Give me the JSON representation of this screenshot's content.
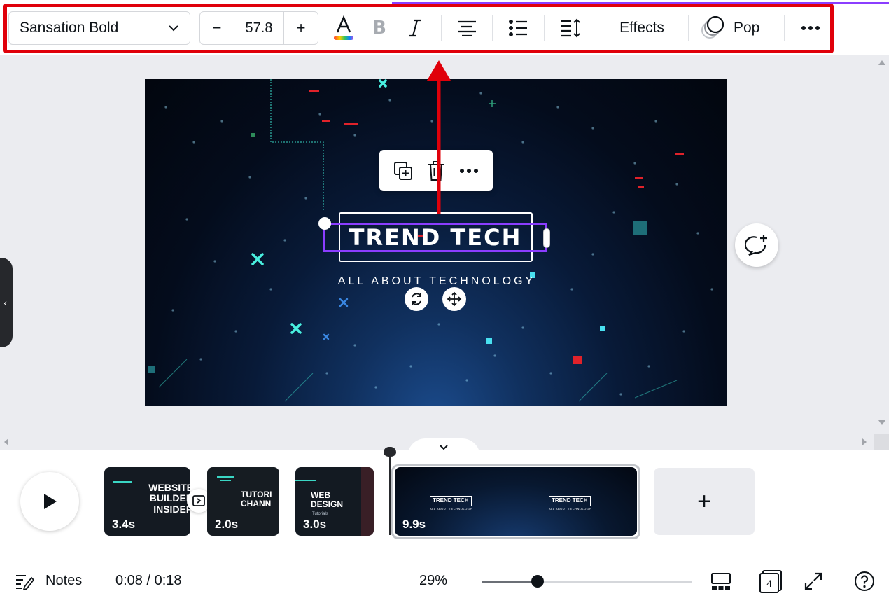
{
  "toolbar": {
    "font_name": "Sansation Bold",
    "font_size": "57.8",
    "decrease_label": "−",
    "increase_label": "+",
    "effects_label": "Effects",
    "animation_label": "Pop",
    "highlight_color": "#e0000a",
    "text_color_icon": "text-color-icon",
    "bold_icon": "bold-icon",
    "italic_icon": "italic-icon",
    "align_icon": "align-center-icon",
    "list_icon": "bullet-list-icon",
    "spacing_icon": "line-spacing-icon",
    "more_icon": "more-icon"
  },
  "canvas": {
    "title": "TREND TECH",
    "subtitle": "ALL ABOUT TECHNOLOGY",
    "selection_color": "#8b3dff"
  },
  "timeline": {
    "clips": [
      {
        "lines": [
          "WEBSITE",
          "BUILDER",
          "INSIDER"
        ],
        "duration": "3.4s"
      },
      {
        "lines": [
          "TUTORI",
          "CHANN"
        ],
        "duration": "2.0s"
      },
      {
        "lines": [
          "WEB",
          "DESIGN"
        ],
        "small": "Tutorials",
        "duration": "3.0s"
      },
      {
        "lines": [
          "TREND TECH",
          "TREND TECH"
        ],
        "small": "ALL ABOUT TECHNOLOGY",
        "duration": "9.9s"
      }
    ],
    "add_page_label": "+"
  },
  "footer": {
    "notes_label": "Notes",
    "time": "0:08 / 0:18",
    "zoom": "29%",
    "zoom_fraction": 0.29,
    "page_count": "4"
  }
}
